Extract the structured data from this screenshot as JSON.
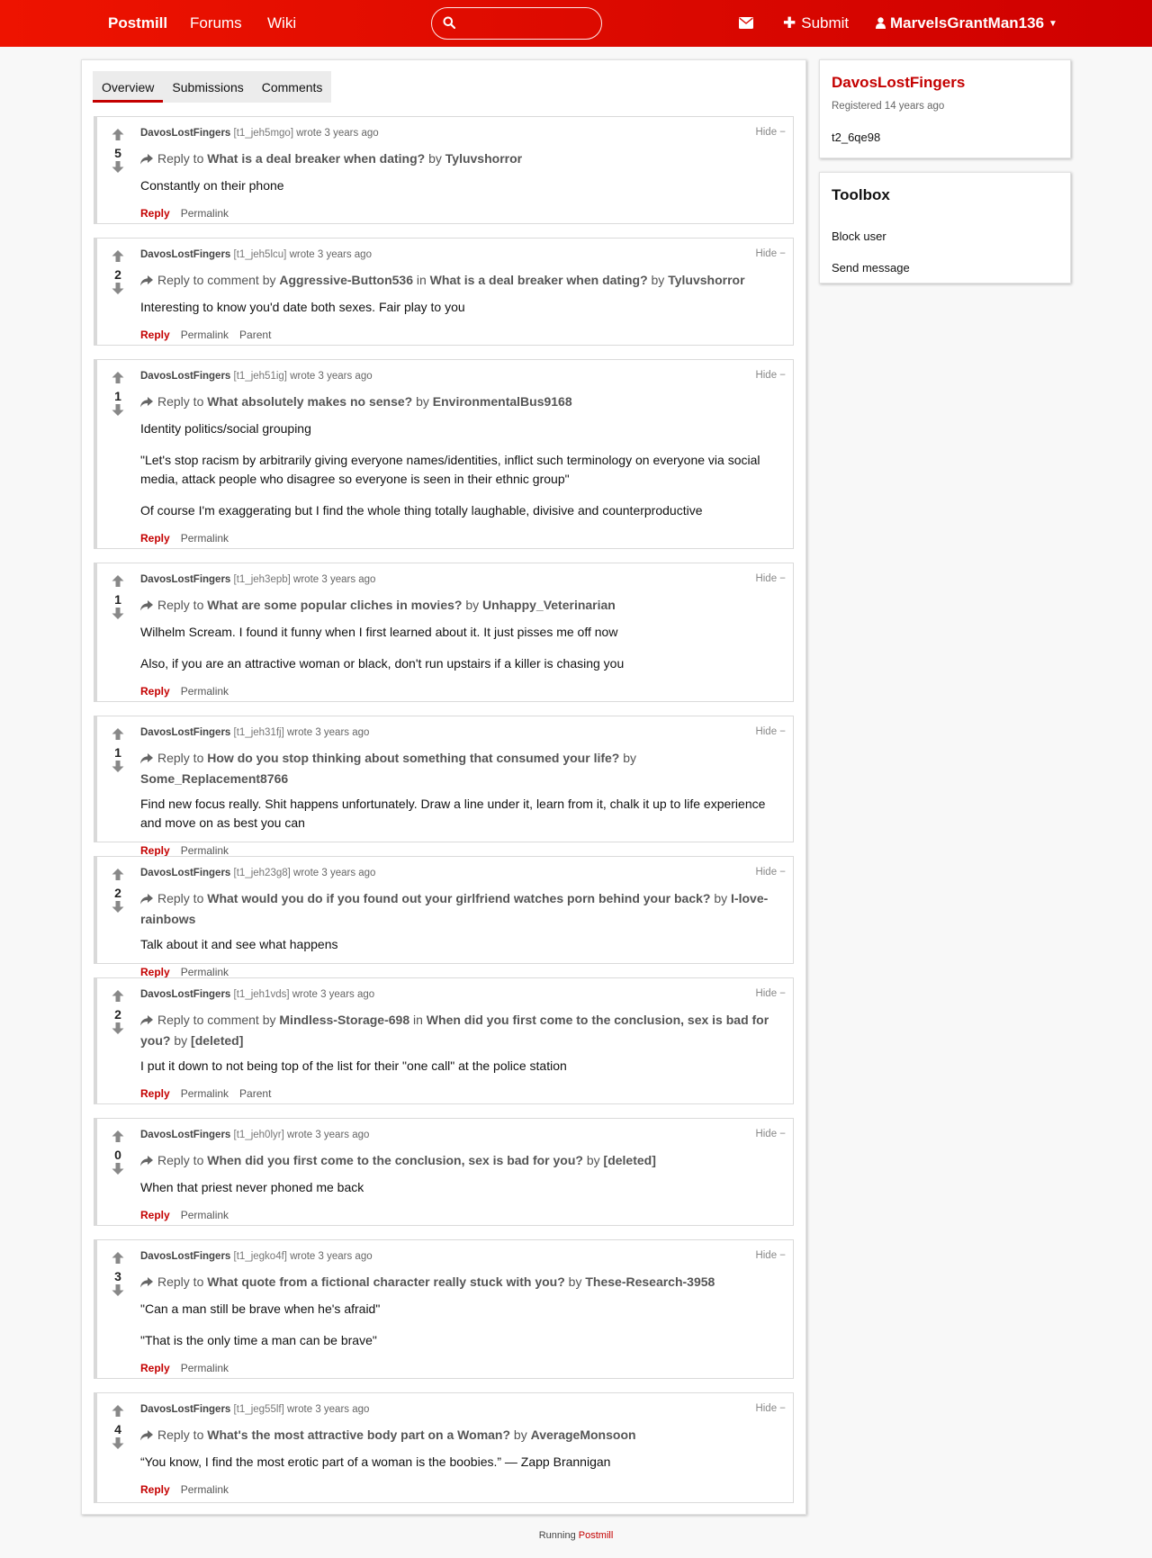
{
  "nav": {
    "brand": "Postmill",
    "forums": "Forums",
    "wiki": "Wiki",
    "search_placeholder": "",
    "submit": "Submit",
    "username": "MarvelsGrantMan136"
  },
  "tabs": [
    {
      "label": "Overview",
      "active": true
    },
    {
      "label": "Submissions",
      "active": false
    },
    {
      "label": "Comments",
      "active": false
    }
  ],
  "comments": [
    {
      "author": "DavosLostFingers",
      "id": "[t1_jeh5mgo]",
      "when": "wrote 3 years ago",
      "score": "5",
      "reply_prefix": "Reply to",
      "reply_target": "What is a deal breaker when dating?",
      "reply_by_word": "by",
      "reply_by": "Tyluvshorror",
      "paragraphs": [
        "Constantly on their phone"
      ],
      "actions": [
        "Reply",
        "Permalink"
      ]
    },
    {
      "author": "DavosLostFingers",
      "id": "[t1_jeh5lcu]",
      "when": "wrote 3 years ago",
      "score": "2",
      "reply_prefix": "Reply to comment by",
      "reply_user": "Aggressive-Button536",
      "reply_in": "in",
      "reply_target": "What is a deal breaker when dating?",
      "reply_by_word": "by",
      "reply_by": "Tyluvshorror",
      "paragraphs": [
        "Interesting to know you'd date both sexes. Fair play to you"
      ],
      "actions": [
        "Reply",
        "Permalink",
        "Parent"
      ]
    },
    {
      "author": "DavosLostFingers",
      "id": "[t1_jeh51ig]",
      "when": "wrote 3 years ago",
      "score": "1",
      "reply_prefix": "Reply to",
      "reply_target": "What absolutely makes no sense?",
      "reply_by_word": "by",
      "reply_by": "EnvironmentalBus9168",
      "paragraphs": [
        "Identity politics/social grouping",
        "\"Let's stop racism by arbitrarily giving everyone names/identities, inflict such terminology on everyone via social media, attack people who disagree so everyone is seen in their ethnic group\"",
        "Of course I'm exaggerating but I find the whole thing totally laughable, divisive and counterproductive"
      ],
      "actions": [
        "Reply",
        "Permalink"
      ]
    },
    {
      "author": "DavosLostFingers",
      "id": "[t1_jeh3epb]",
      "when": "wrote 3 years ago",
      "score": "1",
      "reply_prefix": "Reply to",
      "reply_target": "What are some popular cliches in movies?",
      "reply_by_word": "by",
      "reply_by": "Unhappy_Veterinarian",
      "paragraphs": [
        "Wilhelm Scream. I found it funny when I first learned about it. It just pisses me off now",
        "Also, if you are an attractive woman or black, don't run upstairs if a killer is chasing you"
      ],
      "actions": [
        "Reply",
        "Permalink"
      ]
    },
    {
      "author": "DavosLostFingers",
      "id": "[t1_jeh31fj]",
      "when": "wrote 3 years ago",
      "score": "1",
      "reply_prefix": "Reply to",
      "reply_target": "How do you stop thinking about something that consumed your life?",
      "reply_by_word": "by",
      "reply_by": "Some_Replacement8766",
      "paragraphs": [
        "Find new focus really. Shit happens unfortunately. Draw a line under it, learn from it, chalk it up to life experience and move on as best you can"
      ],
      "actions": [
        "Reply",
        "Permalink"
      ]
    },
    {
      "author": "DavosLostFingers",
      "id": "[t1_jeh23g8]",
      "when": "wrote 3 years ago",
      "score": "2",
      "reply_prefix": "Reply to",
      "reply_target": "What would you do if you found out your girlfriend watches porn behind your back?",
      "reply_by_word": "by",
      "reply_by": "I-love-rainbows",
      "paragraphs": [
        "Talk about it and see what happens"
      ],
      "actions": [
        "Reply",
        "Permalink"
      ]
    },
    {
      "author": "DavosLostFingers",
      "id": "[t1_jeh1vds]",
      "when": "wrote 3 years ago",
      "score": "2",
      "reply_prefix": "Reply to comment by",
      "reply_user": "Mindless-Storage-698",
      "reply_in": "in",
      "reply_target": "When did you first come to the conclusion, sex is bad for you?",
      "reply_by_word": "by",
      "reply_by": "[deleted]",
      "paragraphs": [
        "I put it down to not being top of the list for their \"one call\" at the police station"
      ],
      "actions": [
        "Reply",
        "Permalink",
        "Parent"
      ]
    },
    {
      "author": "DavosLostFingers",
      "id": "[t1_jeh0lyr]",
      "when": "wrote 3 years ago",
      "score": "0",
      "reply_prefix": "Reply to",
      "reply_target": "When did you first come to the conclusion, sex is bad for you?",
      "reply_by_word": "by",
      "reply_by": "[deleted]",
      "paragraphs": [
        "When that priest never phoned me back"
      ],
      "actions": [
        "Reply",
        "Permalink"
      ]
    },
    {
      "author": "DavosLostFingers",
      "id": "[t1_jegko4f]",
      "when": "wrote 3 years ago",
      "score": "3",
      "reply_prefix": "Reply to",
      "reply_target": "What quote from a fictional character really stuck with you?",
      "reply_by_word": "by",
      "reply_by": "These-Research-3958",
      "paragraphs": [
        "\"Can a man still be brave when he's afraid\"",
        "\"That is the only time a man can be brave\""
      ],
      "actions": [
        "Reply",
        "Permalink"
      ]
    },
    {
      "author": "DavosLostFingers",
      "id": "[t1_jeg55lf]",
      "when": "wrote 3 years ago",
      "score": "4",
      "reply_prefix": "Reply to",
      "reply_target": "What's the most attractive body part on a Woman?",
      "reply_by_word": "by",
      "reply_by": "AverageMonsoon",
      "paragraphs": [
        "“You know, I find the most erotic part of a woman is the boobies.” — Zapp Brannigan"
      ],
      "actions": [
        "Reply",
        "Permalink"
      ]
    }
  ],
  "hide_label": "Hide −",
  "profile": {
    "name": "DavosLostFingers",
    "registered": "Registered 14 years ago",
    "id": "t2_6qe98"
  },
  "toolbox": {
    "title": "Toolbox",
    "block": "Block user",
    "message": "Send message"
  },
  "footer": {
    "prefix": "Running",
    "link": "Postmill"
  },
  "colors": {
    "header": "#dd0a00",
    "accent": "#c40000"
  },
  "icons": [
    "search-icon",
    "envelope-icon",
    "plus-icon",
    "user-icon",
    "caret-down-icon",
    "upvote-icon",
    "downvote-icon",
    "reply-arrow-icon"
  ]
}
